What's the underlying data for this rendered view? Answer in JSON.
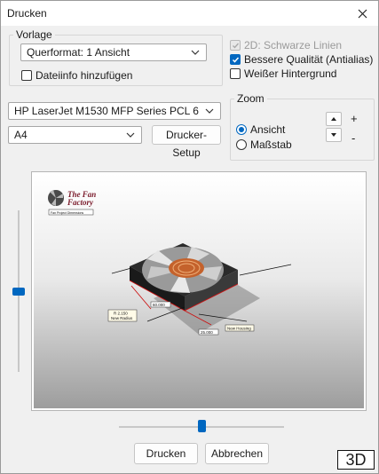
{
  "window": {
    "title": "Drucken"
  },
  "vorlage": {
    "group_label": "Vorlage",
    "template_value": "Querformat: 1 Ansicht",
    "fileinfo_label": "Dateiinfo hinzufügen"
  },
  "options": {
    "black_lines_label": "2D: Schwarze Linien",
    "quality_label": "Bessere Qualität (Antialias)",
    "white_bg_label": "Weißer Hintergrund"
  },
  "printer": {
    "printer_value": "HP LaserJet M1530 MFP Series PCL 6",
    "paper_value": "A4",
    "setup_label": "Drucker-Setup"
  },
  "zoom": {
    "group_label": "Zoom",
    "view_label": "Ansicht",
    "scale_label": "Maßstab",
    "plus": "+",
    "minus": "-"
  },
  "preview": {
    "logo_line1": "The Fan",
    "logo_line2": "Factory",
    "logo_sub": "Fan Project Dimensions",
    "dim_radius_value": "R 2.150",
    "dim_radius_label": "New Radius",
    "dim_width_value": "60.000",
    "dim_depth_value": "25.000",
    "dim_housing_label": "New Housing"
  },
  "footer": {
    "print_label": "Drucken",
    "cancel_label": "Abbrechen",
    "mode_badge": "3D"
  },
  "colors": {
    "accent": "#0067c0"
  }
}
